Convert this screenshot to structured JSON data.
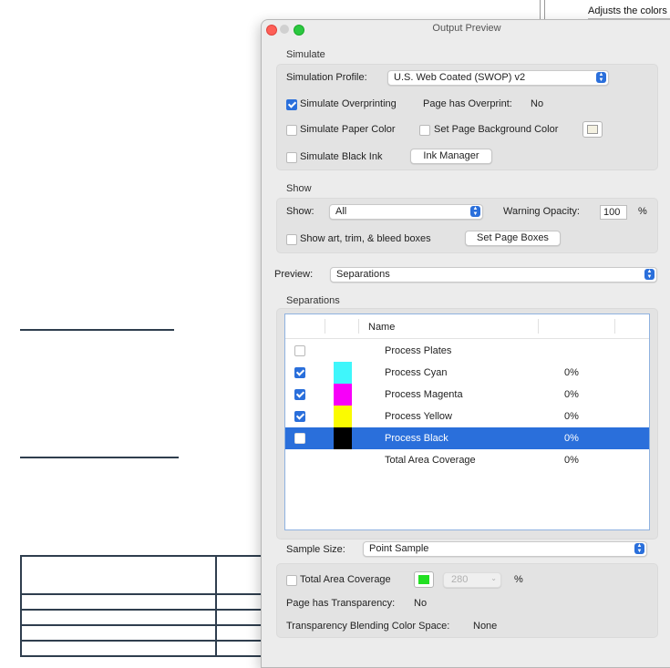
{
  "side_note": {
    "text": "Adjusts the colors"
  },
  "window": {
    "title": "Output Preview"
  },
  "simulate": {
    "section": "Simulate",
    "profile_label": "Simulation Profile:",
    "profile_value": "U.S. Web Coated (SWOP) v2",
    "simulate_overprinting": {
      "label": "Simulate Overprinting",
      "checked": true
    },
    "overprint_label": "Page has Overprint:",
    "overprint_value": "No",
    "paper_color": {
      "label": "Simulate Paper Color",
      "checked": false
    },
    "page_background": {
      "label": "Set Page Background Color",
      "checked": false
    },
    "page_background_color": "#f4f1e1",
    "black_ink": {
      "label": "Simulate Black Ink",
      "checked": false
    },
    "ink_manager_label": "Ink Manager"
  },
  "show": {
    "section": "Show",
    "show_label": "Show:",
    "show_value": "All",
    "warning_label": "Warning Opacity:",
    "warning_value": "100",
    "warning_unit": "%",
    "boxes": {
      "label": "Show art, trim, & bleed boxes",
      "checked": false
    },
    "set_boxes_label": "Set Page Boxes"
  },
  "preview": {
    "label": "Preview:",
    "value": "Separations"
  },
  "separations": {
    "section": "Separations",
    "col_name": "Name",
    "rows": [
      {
        "name": "Process Plates",
        "pct": "",
        "color": "",
        "checked": false,
        "selected": false
      },
      {
        "name": "Process Cyan",
        "pct": "0%",
        "color": "#3ff6fb",
        "checked": true,
        "selected": false
      },
      {
        "name": "Process Magenta",
        "pct": "0%",
        "color": "#f700f9",
        "checked": true,
        "selected": false
      },
      {
        "name": "Process Yellow",
        "pct": "0%",
        "color": "#fbfb00",
        "checked": true,
        "selected": false
      },
      {
        "name": "Process Black",
        "pct": "0%",
        "color": "#000000",
        "checked": false,
        "selected": true
      },
      {
        "name": "Total Area Coverage",
        "pct": "0%",
        "color": "",
        "checked": null,
        "selected": false
      }
    ]
  },
  "bottom": {
    "sample_label": "Sample Size:",
    "sample_value": "Point Sample",
    "total_coverage": {
      "label": "Total Area Coverage",
      "checked": false
    },
    "coverage_color": "#22e022",
    "coverage_value": "280",
    "coverage_unit": "%",
    "transparency_label": "Page has Transparency:",
    "transparency_value": "No",
    "blending_label": "Transparency Blending Color Space:",
    "blending_value": "None"
  },
  "colors": {
    "accent": "#2a6fdb"
  }
}
